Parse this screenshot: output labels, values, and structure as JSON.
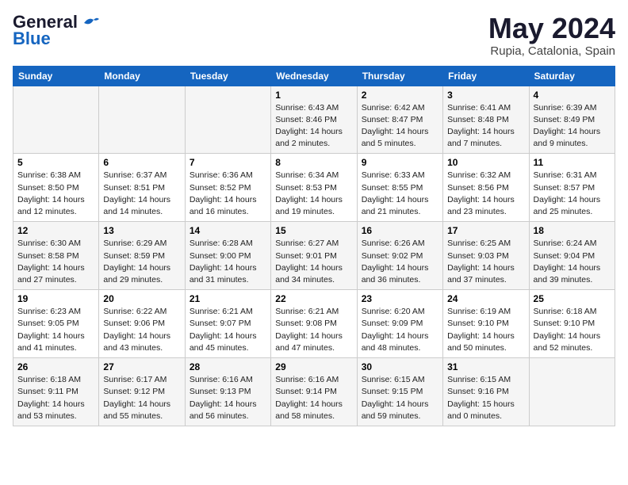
{
  "header": {
    "logo_line1": "General",
    "logo_line2": "Blue",
    "month_year": "May 2024",
    "location": "Rupia, Catalonia, Spain"
  },
  "days_of_week": [
    "Sunday",
    "Monday",
    "Tuesday",
    "Wednesday",
    "Thursday",
    "Friday",
    "Saturday"
  ],
  "weeks": [
    [
      {
        "day": "",
        "info": ""
      },
      {
        "day": "",
        "info": ""
      },
      {
        "day": "",
        "info": ""
      },
      {
        "day": "1",
        "info": "Sunrise: 6:43 AM\nSunset: 8:46 PM\nDaylight: 14 hours\nand 2 minutes."
      },
      {
        "day": "2",
        "info": "Sunrise: 6:42 AM\nSunset: 8:47 PM\nDaylight: 14 hours\nand 5 minutes."
      },
      {
        "day": "3",
        "info": "Sunrise: 6:41 AM\nSunset: 8:48 PM\nDaylight: 14 hours\nand 7 minutes."
      },
      {
        "day": "4",
        "info": "Sunrise: 6:39 AM\nSunset: 8:49 PM\nDaylight: 14 hours\nand 9 minutes."
      }
    ],
    [
      {
        "day": "5",
        "info": "Sunrise: 6:38 AM\nSunset: 8:50 PM\nDaylight: 14 hours\nand 12 minutes."
      },
      {
        "day": "6",
        "info": "Sunrise: 6:37 AM\nSunset: 8:51 PM\nDaylight: 14 hours\nand 14 minutes."
      },
      {
        "day": "7",
        "info": "Sunrise: 6:36 AM\nSunset: 8:52 PM\nDaylight: 14 hours\nand 16 minutes."
      },
      {
        "day": "8",
        "info": "Sunrise: 6:34 AM\nSunset: 8:53 PM\nDaylight: 14 hours\nand 19 minutes."
      },
      {
        "day": "9",
        "info": "Sunrise: 6:33 AM\nSunset: 8:55 PM\nDaylight: 14 hours\nand 21 minutes."
      },
      {
        "day": "10",
        "info": "Sunrise: 6:32 AM\nSunset: 8:56 PM\nDaylight: 14 hours\nand 23 minutes."
      },
      {
        "day": "11",
        "info": "Sunrise: 6:31 AM\nSunset: 8:57 PM\nDaylight: 14 hours\nand 25 minutes."
      }
    ],
    [
      {
        "day": "12",
        "info": "Sunrise: 6:30 AM\nSunset: 8:58 PM\nDaylight: 14 hours\nand 27 minutes."
      },
      {
        "day": "13",
        "info": "Sunrise: 6:29 AM\nSunset: 8:59 PM\nDaylight: 14 hours\nand 29 minutes."
      },
      {
        "day": "14",
        "info": "Sunrise: 6:28 AM\nSunset: 9:00 PM\nDaylight: 14 hours\nand 31 minutes."
      },
      {
        "day": "15",
        "info": "Sunrise: 6:27 AM\nSunset: 9:01 PM\nDaylight: 14 hours\nand 34 minutes."
      },
      {
        "day": "16",
        "info": "Sunrise: 6:26 AM\nSunset: 9:02 PM\nDaylight: 14 hours\nand 36 minutes."
      },
      {
        "day": "17",
        "info": "Sunrise: 6:25 AM\nSunset: 9:03 PM\nDaylight: 14 hours\nand 37 minutes."
      },
      {
        "day": "18",
        "info": "Sunrise: 6:24 AM\nSunset: 9:04 PM\nDaylight: 14 hours\nand 39 minutes."
      }
    ],
    [
      {
        "day": "19",
        "info": "Sunrise: 6:23 AM\nSunset: 9:05 PM\nDaylight: 14 hours\nand 41 minutes."
      },
      {
        "day": "20",
        "info": "Sunrise: 6:22 AM\nSunset: 9:06 PM\nDaylight: 14 hours\nand 43 minutes."
      },
      {
        "day": "21",
        "info": "Sunrise: 6:21 AM\nSunset: 9:07 PM\nDaylight: 14 hours\nand 45 minutes."
      },
      {
        "day": "22",
        "info": "Sunrise: 6:21 AM\nSunset: 9:08 PM\nDaylight: 14 hours\nand 47 minutes."
      },
      {
        "day": "23",
        "info": "Sunrise: 6:20 AM\nSunset: 9:09 PM\nDaylight: 14 hours\nand 48 minutes."
      },
      {
        "day": "24",
        "info": "Sunrise: 6:19 AM\nSunset: 9:10 PM\nDaylight: 14 hours\nand 50 minutes."
      },
      {
        "day": "25",
        "info": "Sunrise: 6:18 AM\nSunset: 9:10 PM\nDaylight: 14 hours\nand 52 minutes."
      }
    ],
    [
      {
        "day": "26",
        "info": "Sunrise: 6:18 AM\nSunset: 9:11 PM\nDaylight: 14 hours\nand 53 minutes."
      },
      {
        "day": "27",
        "info": "Sunrise: 6:17 AM\nSunset: 9:12 PM\nDaylight: 14 hours\nand 55 minutes."
      },
      {
        "day": "28",
        "info": "Sunrise: 6:16 AM\nSunset: 9:13 PM\nDaylight: 14 hours\nand 56 minutes."
      },
      {
        "day": "29",
        "info": "Sunrise: 6:16 AM\nSunset: 9:14 PM\nDaylight: 14 hours\nand 58 minutes."
      },
      {
        "day": "30",
        "info": "Sunrise: 6:15 AM\nSunset: 9:15 PM\nDaylight: 14 hours\nand 59 minutes."
      },
      {
        "day": "31",
        "info": "Sunrise: 6:15 AM\nSunset: 9:16 PM\nDaylight: 15 hours\nand 0 minutes."
      },
      {
        "day": "",
        "info": ""
      }
    ]
  ]
}
